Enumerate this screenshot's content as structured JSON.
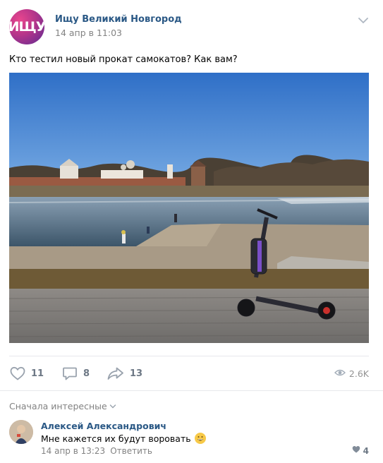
{
  "group": {
    "name": "Ищу Великий Новгород",
    "avatar_text": "ИЩУ",
    "date": "14 апр в 11:03"
  },
  "post": {
    "text": "Кто тестил новый прокат самокатов? Как вам?",
    "photo_icon": "photo-scooter-river"
  },
  "actions": {
    "likes": "11",
    "comments": "8",
    "shares": "13",
    "views": "2.6K"
  },
  "comments_section": {
    "sort_label": "Сначала интересные"
  },
  "comment": {
    "author": "Алексей Александрович",
    "text": "Мне кажется их будут воровать",
    "emoji": "grinning-face-icon",
    "date": "14 апр в 13:23",
    "reply_label": "Ответить",
    "likes": "4"
  },
  "colors": {
    "link": "#2a5885",
    "muted": "#828282",
    "icon": "#99a2ad",
    "divider": "#e7e8ec",
    "heart_small": "#818c99"
  }
}
